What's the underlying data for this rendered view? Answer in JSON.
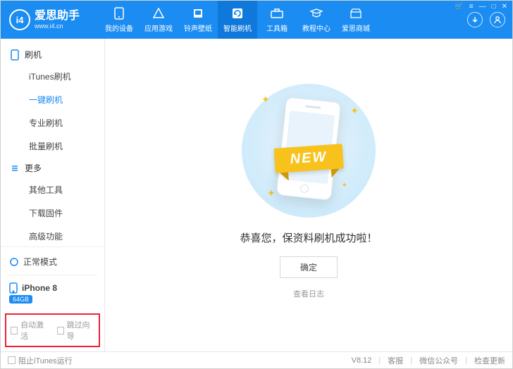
{
  "brand": {
    "title": "爱思助手",
    "subtitle": "www.i4.cn",
    "logo_text": "i4"
  },
  "nav": [
    {
      "key": "device",
      "label": "我的设备"
    },
    {
      "key": "apps",
      "label": "应用游戏"
    },
    {
      "key": "ring",
      "label": "铃声壁纸"
    },
    {
      "key": "flash",
      "label": "智能刷机",
      "active": true
    },
    {
      "key": "tools",
      "label": "工具箱"
    },
    {
      "key": "tut",
      "label": "教程中心"
    },
    {
      "key": "store",
      "label": "爱思商城"
    }
  ],
  "sidebar": {
    "groups": [
      {
        "title": "刷机",
        "icon": "phone",
        "items": [
          {
            "label": "iTunes刷机"
          },
          {
            "label": "一键刷机",
            "selected": true
          },
          {
            "label": "专业刷机"
          },
          {
            "label": "批量刷机"
          }
        ]
      },
      {
        "title": "更多",
        "icon": "list",
        "items": [
          {
            "label": "其他工具"
          },
          {
            "label": "下载固件"
          },
          {
            "label": "高级功能"
          }
        ]
      }
    ],
    "mode_label": "正常模式",
    "device_name": "iPhone 8",
    "device_badge": "64GB",
    "checks": [
      {
        "label": "自动激活"
      },
      {
        "label": "跳过向导"
      }
    ]
  },
  "main": {
    "ribbon": "NEW",
    "success": "恭喜您，保资料刷机成功啦！",
    "ok": "确定",
    "view_log": "查看日志"
  },
  "footer": {
    "block_itunes": "阻止iTunes运行",
    "version": "V8.12",
    "support": "客服",
    "wechat": "微信公众号",
    "update": "检查更新"
  }
}
